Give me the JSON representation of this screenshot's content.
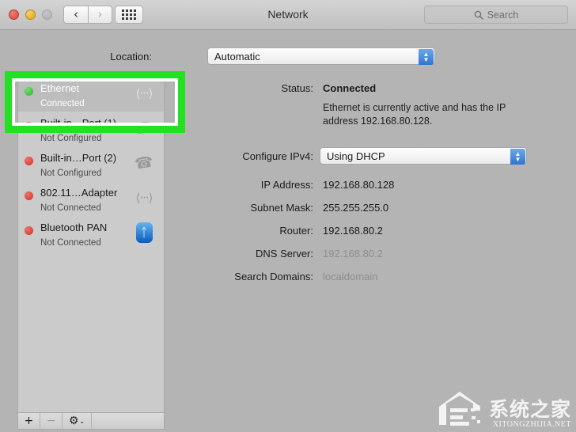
{
  "window": {
    "title": "Network",
    "traffic_lights": [
      "close",
      "minimize",
      "zoom-disabled"
    ]
  },
  "toolbar": {
    "back_icon": "‹",
    "forward_icon": "›",
    "grid_icon": "show-all-grid",
    "search_placeholder": "Search",
    "search_icon": "search-icon"
  },
  "location": {
    "label": "Location:",
    "value": "Automatic"
  },
  "sidebar": {
    "items": [
      {
        "name": "Ethernet",
        "state": "Connected",
        "dot": "green",
        "icon": "ethernet-icon",
        "selected": true
      },
      {
        "name": "Built-in…Port (1)",
        "state": "Not Configured",
        "dot": "red",
        "icon": "modem-icon",
        "selected": false
      },
      {
        "name": "Built-in…Port (2)",
        "state": "Not Configured",
        "dot": "red",
        "icon": "modem-icon",
        "selected": false
      },
      {
        "name": "802.11…Adapter",
        "state": "Not Connected",
        "dot": "red",
        "icon": "ethernet-icon",
        "selected": false
      },
      {
        "name": "Bluetooth PAN",
        "state": "Not Connected",
        "dot": "red",
        "icon": "bluetooth-icon",
        "selected": false
      }
    ],
    "toolbar": {
      "add_label": "+",
      "remove_label": "−",
      "gear_label": "⚙",
      "gear_chevron": "⌄"
    }
  },
  "detail": {
    "status_label": "Status:",
    "status_value": "Connected",
    "status_description": "Ethernet is currently active and has the IP address 192.168.80.128.",
    "configure_label": "Configure IPv4:",
    "configure_value": "Using DHCP",
    "fields": [
      {
        "label": "IP Address:",
        "value": "192.168.80.128",
        "muted": false
      },
      {
        "label": "Subnet Mask:",
        "value": "255.255.255.0",
        "muted": false
      },
      {
        "label": "Router:",
        "value": "192.168.80.2",
        "muted": false
      },
      {
        "label": "DNS Server:",
        "value": "192.168.80.2",
        "muted": true
      },
      {
        "label": "Search Domains:",
        "value": "localdomain",
        "muted": true
      }
    ]
  },
  "annotation": {
    "color": "#22e022",
    "target": "Ethernet"
  },
  "watermark": {
    "chinese": "系统之家",
    "english": "XITONGZHIJIA.NET"
  }
}
